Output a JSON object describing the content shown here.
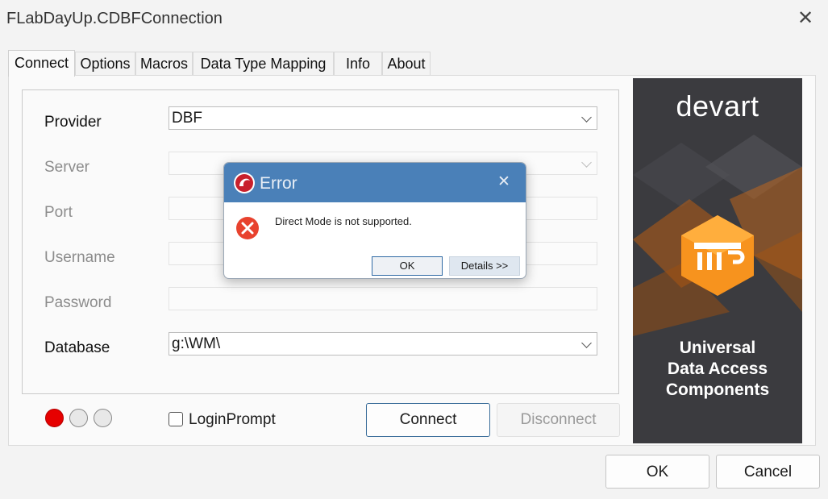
{
  "window": {
    "title": "FLabDayUp.CDBFConnection"
  },
  "tabs": [
    {
      "label": "Connect"
    },
    {
      "label": "Options"
    },
    {
      "label": "Macros"
    },
    {
      "label": "Data Type Mapping"
    },
    {
      "label": "Info"
    },
    {
      "label": "About"
    }
  ],
  "form": {
    "provider_label": "Provider",
    "provider_value": "DBF",
    "server_label": "Server",
    "server_value": "",
    "port_label": "Port",
    "port_value": "",
    "username_label": "Username",
    "username_value": "",
    "password_label": "Password",
    "password_value": "",
    "database_label": "Database",
    "database_value": "g:\\WM\\"
  },
  "login_prompt": {
    "label": "LoginPrompt",
    "checked": false
  },
  "buttons": {
    "connect": "Connect",
    "disconnect": "Disconnect",
    "ok": "OK",
    "cancel": "Cancel"
  },
  "banner": {
    "logo": "devart",
    "line1": "Universal",
    "line2": "Data Access",
    "line3": "Components",
    "accent_color": "#f7931e"
  },
  "error_dialog": {
    "title": "Error",
    "message": "Direct Mode is not supported.",
    "ok": "OK",
    "details": "Details >>"
  },
  "colors": {
    "status_red": "#e60000",
    "dialog_titlebar": "#4a80b8",
    "error_icon": "#e8422e"
  }
}
